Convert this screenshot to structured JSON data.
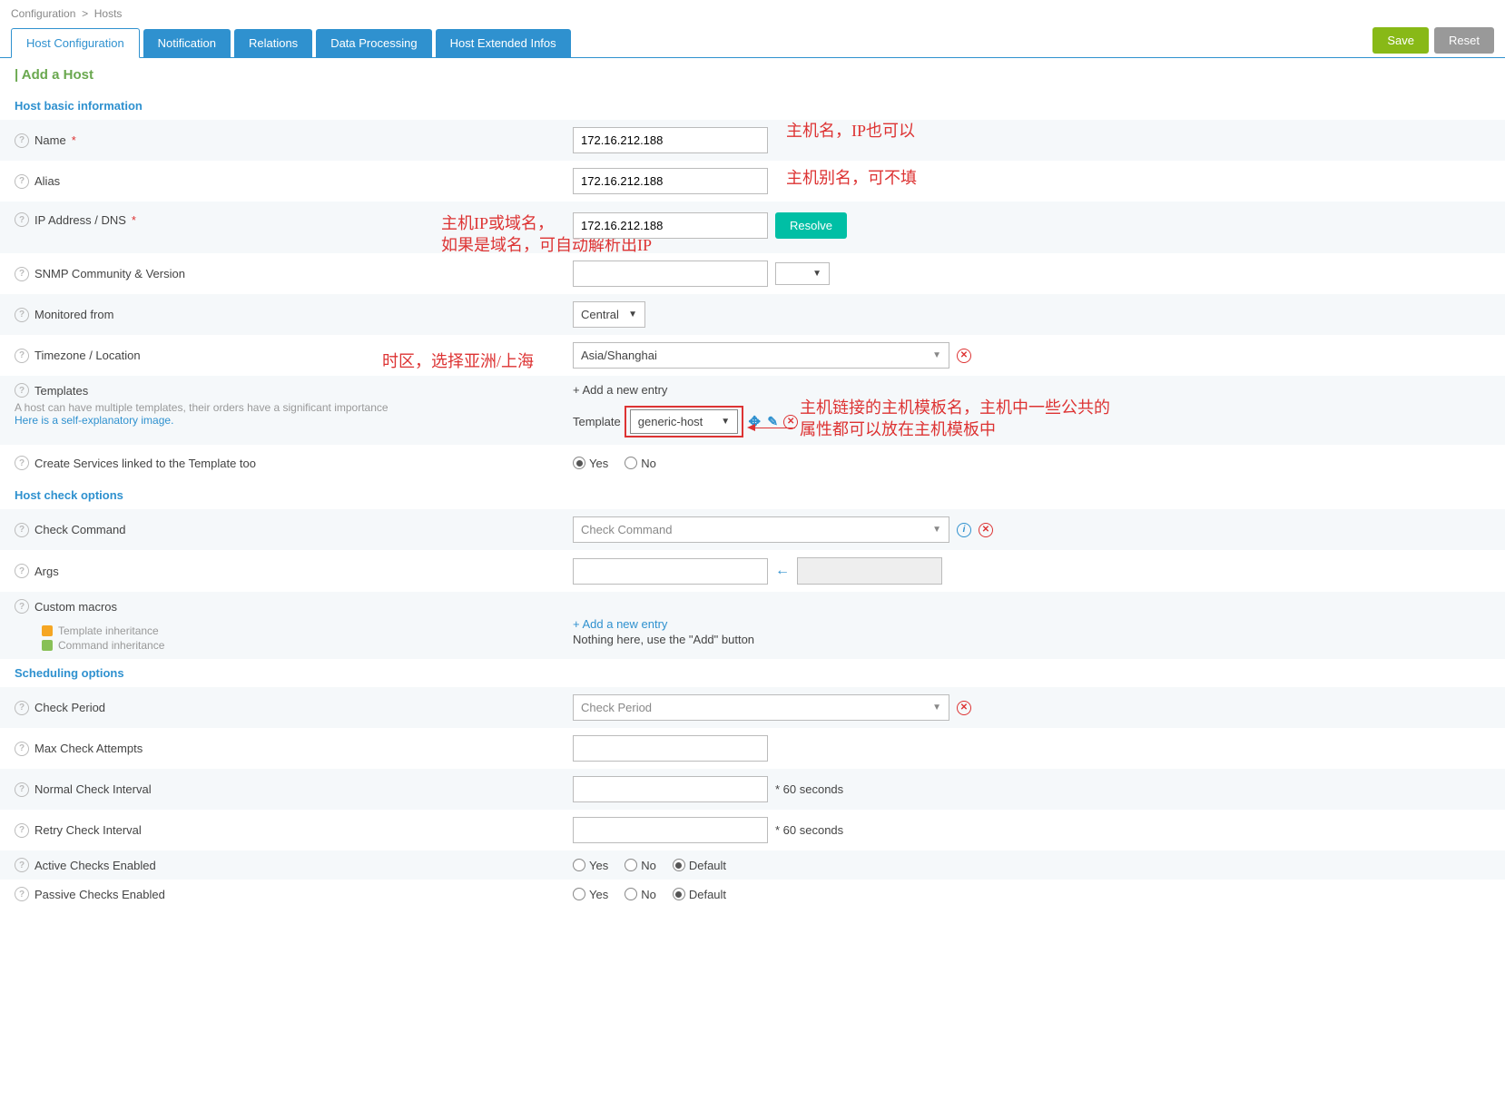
{
  "breadcrumb": {
    "item1": "Configuration",
    "sep": ">",
    "item2": "Hosts"
  },
  "tabs": {
    "t0": "Host Configuration",
    "t1": "Notification",
    "t2": "Relations",
    "t3": "Data Processing",
    "t4": "Host Extended Infos"
  },
  "buttons": {
    "save": "Save",
    "reset": "Reset",
    "resolve": "Resolve"
  },
  "page_title": "| Add a Host",
  "sections": {
    "basic": "Host basic information",
    "check": "Host check options",
    "sched": "Scheduling options"
  },
  "fields": {
    "name": {
      "label": "Name",
      "value": "172.16.212.188"
    },
    "alias": {
      "label": "Alias",
      "value": "172.16.212.188"
    },
    "ip": {
      "label": "IP Address / DNS",
      "value": "172.16.212.188"
    },
    "snmp": {
      "label": "SNMP Community & Version",
      "value": ""
    },
    "monitored": {
      "label": "Monitored from",
      "value": "Central"
    },
    "timezone": {
      "label": "Timezone / Location",
      "value": "Asia/Shanghai"
    },
    "templates": {
      "label": "Templates",
      "help1": "A host can have multiple templates, their orders have a significant importance",
      "help2": "Here is a self-explanatory image.",
      "add_entry": "+ Add a new entry",
      "tmpl_label": "Template",
      "tmpl_value": "generic-host"
    },
    "create_svc": {
      "label": "Create Services linked to the Template too",
      "yes": "Yes",
      "no": "No"
    },
    "check_cmd": {
      "label": "Check Command",
      "placeholder": "Check Command"
    },
    "args": {
      "label": "Args"
    },
    "macros": {
      "label": "Custom macros",
      "inh1": "Template inheritance",
      "inh2": "Command inheritance",
      "add": "+ Add a new entry",
      "nothing": "Nothing here, use the \"Add\" button"
    },
    "check_period": {
      "label": "Check Period",
      "placeholder": "Check Period"
    },
    "max_attempts": {
      "label": "Max Check Attempts"
    },
    "normal_int": {
      "label": "Normal Check Interval",
      "suffix": "* 60 seconds"
    },
    "retry_int": {
      "label": "Retry Check Interval",
      "suffix": "* 60 seconds"
    },
    "active": {
      "label": "Active Checks Enabled"
    },
    "passive": {
      "label": "Passive Checks Enabled"
    },
    "radio": {
      "yes": "Yes",
      "no": "No",
      "def": "Default"
    }
  },
  "annotations": {
    "name": "主机名，IP也可以",
    "alias": "主机别名，可不填",
    "ip1": "主机IP或域名，",
    "ip2": "如果是域名，可自动解析出IP",
    "tz": "时区，选择亚洲/上海",
    "tmpl1": "主机链接的主机模板名，主机中一些公共的",
    "tmpl2": "属性都可以放在主机模板中"
  }
}
